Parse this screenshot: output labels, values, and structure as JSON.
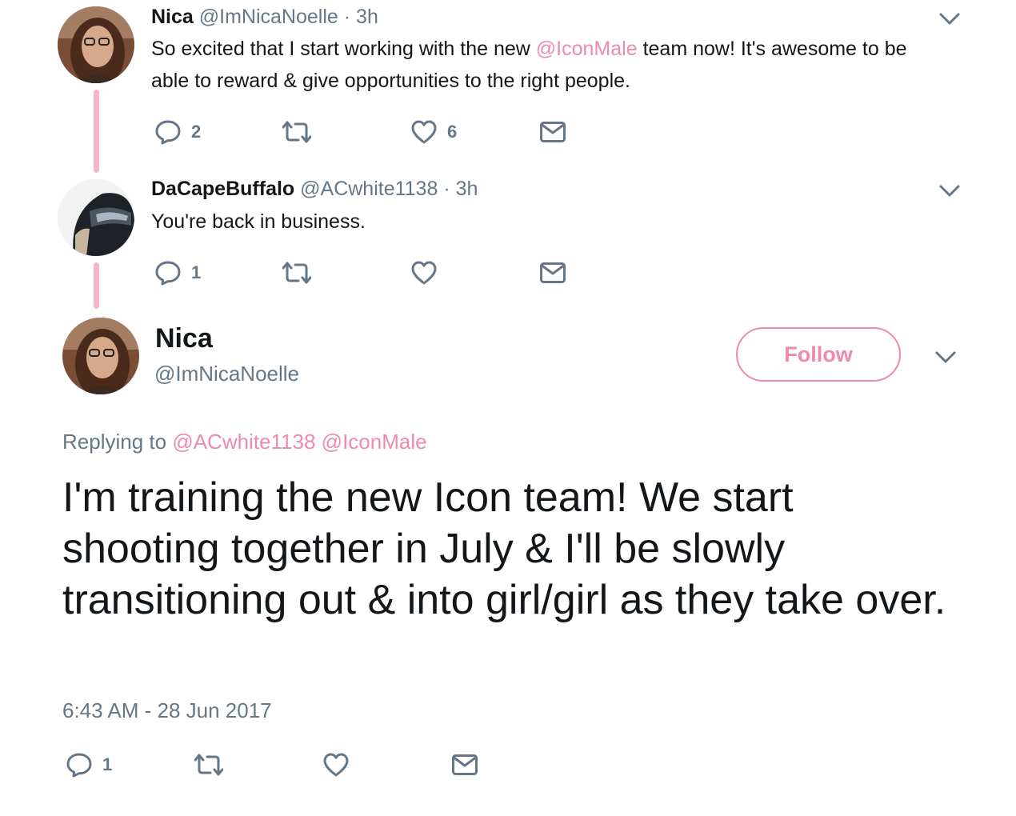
{
  "accent_color": "#f08aac",
  "thread_line_color": "#f7b3c9",
  "tweet1": {
    "name": "Nica",
    "handle": "@ImNicaNoelle",
    "time": "· 3h",
    "text_before": "So excited that I start working with the new ",
    "mention": "@IconMale",
    "text_after": " team now! It's awesome to be able to reward & give opportunities to the right people.",
    "reply_count": "2",
    "retweet_count": "",
    "like_count": "6"
  },
  "tweet2": {
    "name": "DaCapeBuffalo",
    "handle": "@ACwhite1138",
    "time": "· 3h",
    "text": "You're back in business.",
    "reply_count": "1",
    "retweet_count": "",
    "like_count": ""
  },
  "main_tweet": {
    "name": "Nica",
    "handle": "@ImNicaNoelle",
    "follow_label": "Follow",
    "replying_label": "Replying to",
    "replying_mentions": [
      "@ACwhite1138",
      "@IconMale"
    ],
    "text": "I'm training the new Icon team! We start shooting together in July & I'll be slowly transitioning out & into girl/girl as they take over.",
    "timestamp": "6:43 AM - 28 Jun 2017",
    "reply_count": "1",
    "retweet_count": "",
    "like_count": ""
  },
  "icons": {
    "reply": "reply-bubble-icon",
    "retweet": "retweet-icon",
    "like": "heart-icon",
    "dm": "envelope-icon",
    "caret": "chevron-down-icon"
  }
}
